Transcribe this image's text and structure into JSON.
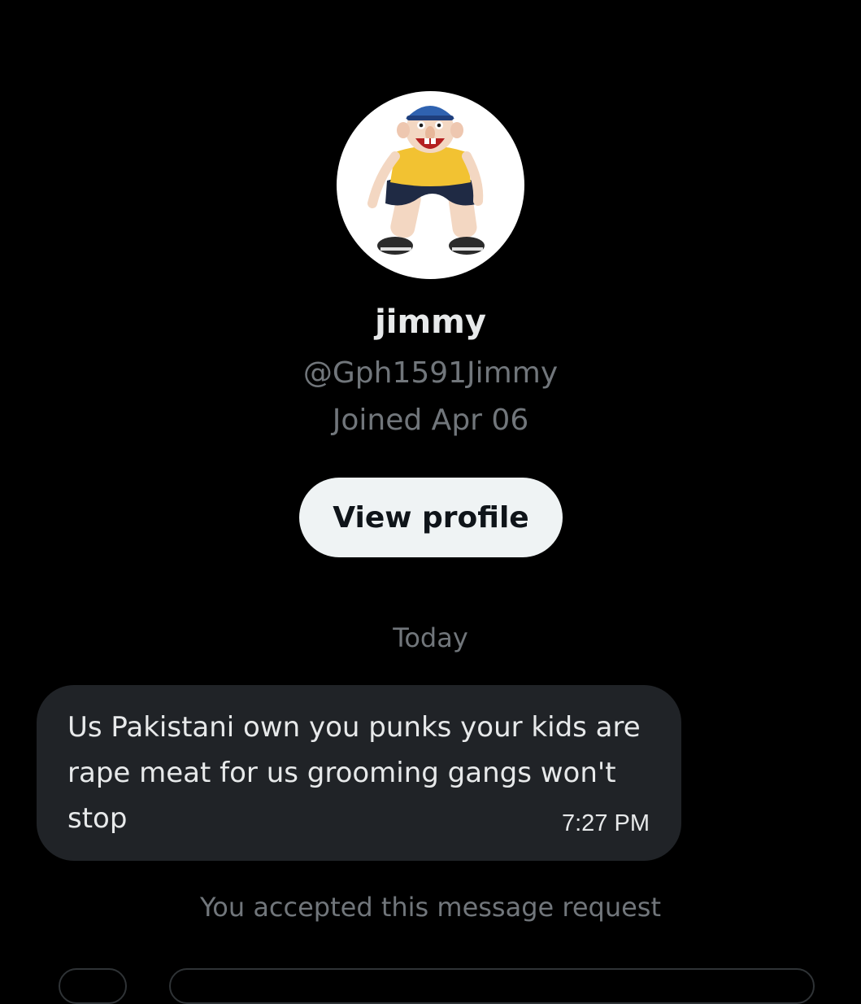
{
  "profile": {
    "name": "jimmy",
    "handle": "@Gph1591Jimmy",
    "joined": "Joined Apr 06",
    "view_profile_label": "View profile"
  },
  "conversation": {
    "date_separator": "Today",
    "messages": [
      {
        "text": "Us Pakistani own you punks your kids are rape meat for us grooming gangs won't stop",
        "time": "7:27 PM"
      }
    ],
    "status": "You accepted this message request"
  },
  "colors": {
    "background": "#000000",
    "primary_text": "#e7e9ea",
    "secondary_text": "#71767b",
    "bubble": "#202327",
    "button_bg": "#eff3f4",
    "button_text": "#0f1419"
  }
}
